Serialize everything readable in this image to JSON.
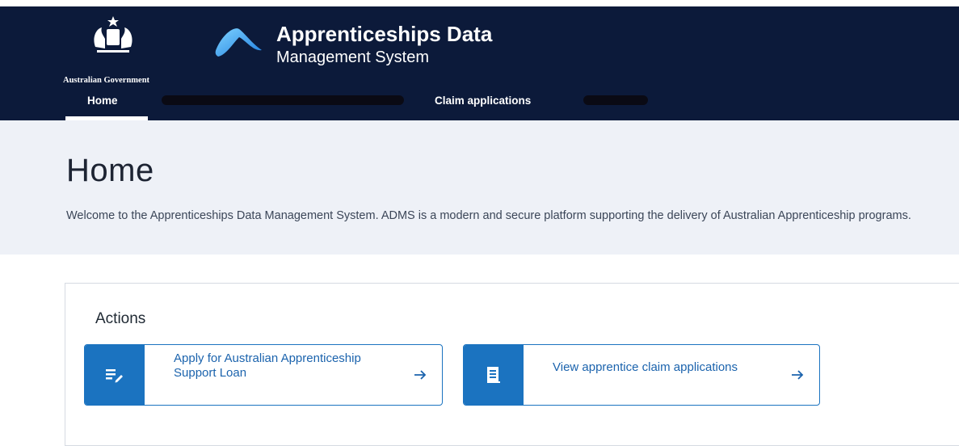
{
  "header": {
    "gov_label": "Australian Government",
    "title_main": "Apprenticeships Data",
    "title_sub": "Management System",
    "bg_color": "#0c1a3a"
  },
  "nav": {
    "items": [
      {
        "label": "Home",
        "active": true
      },
      {
        "label": "Claim applications",
        "active": false
      }
    ]
  },
  "hero": {
    "title": "Home",
    "welcome": "Welcome to the Apprenticeships Data Management System. ADMS is a modern and secure platform supporting the delivery of Australian Apprenticeship programs."
  },
  "actions": {
    "heading": "Actions",
    "cards": [
      {
        "label": "Apply for Australian Apprenticeship Support Loan",
        "icon": "edit-list-icon",
        "arrow": "arrow-right-icon"
      },
      {
        "label": "View apprentice claim applications",
        "icon": "document-list-icon",
        "arrow": "arrow-right-icon"
      }
    ],
    "accent_color": "#1b73c0"
  }
}
